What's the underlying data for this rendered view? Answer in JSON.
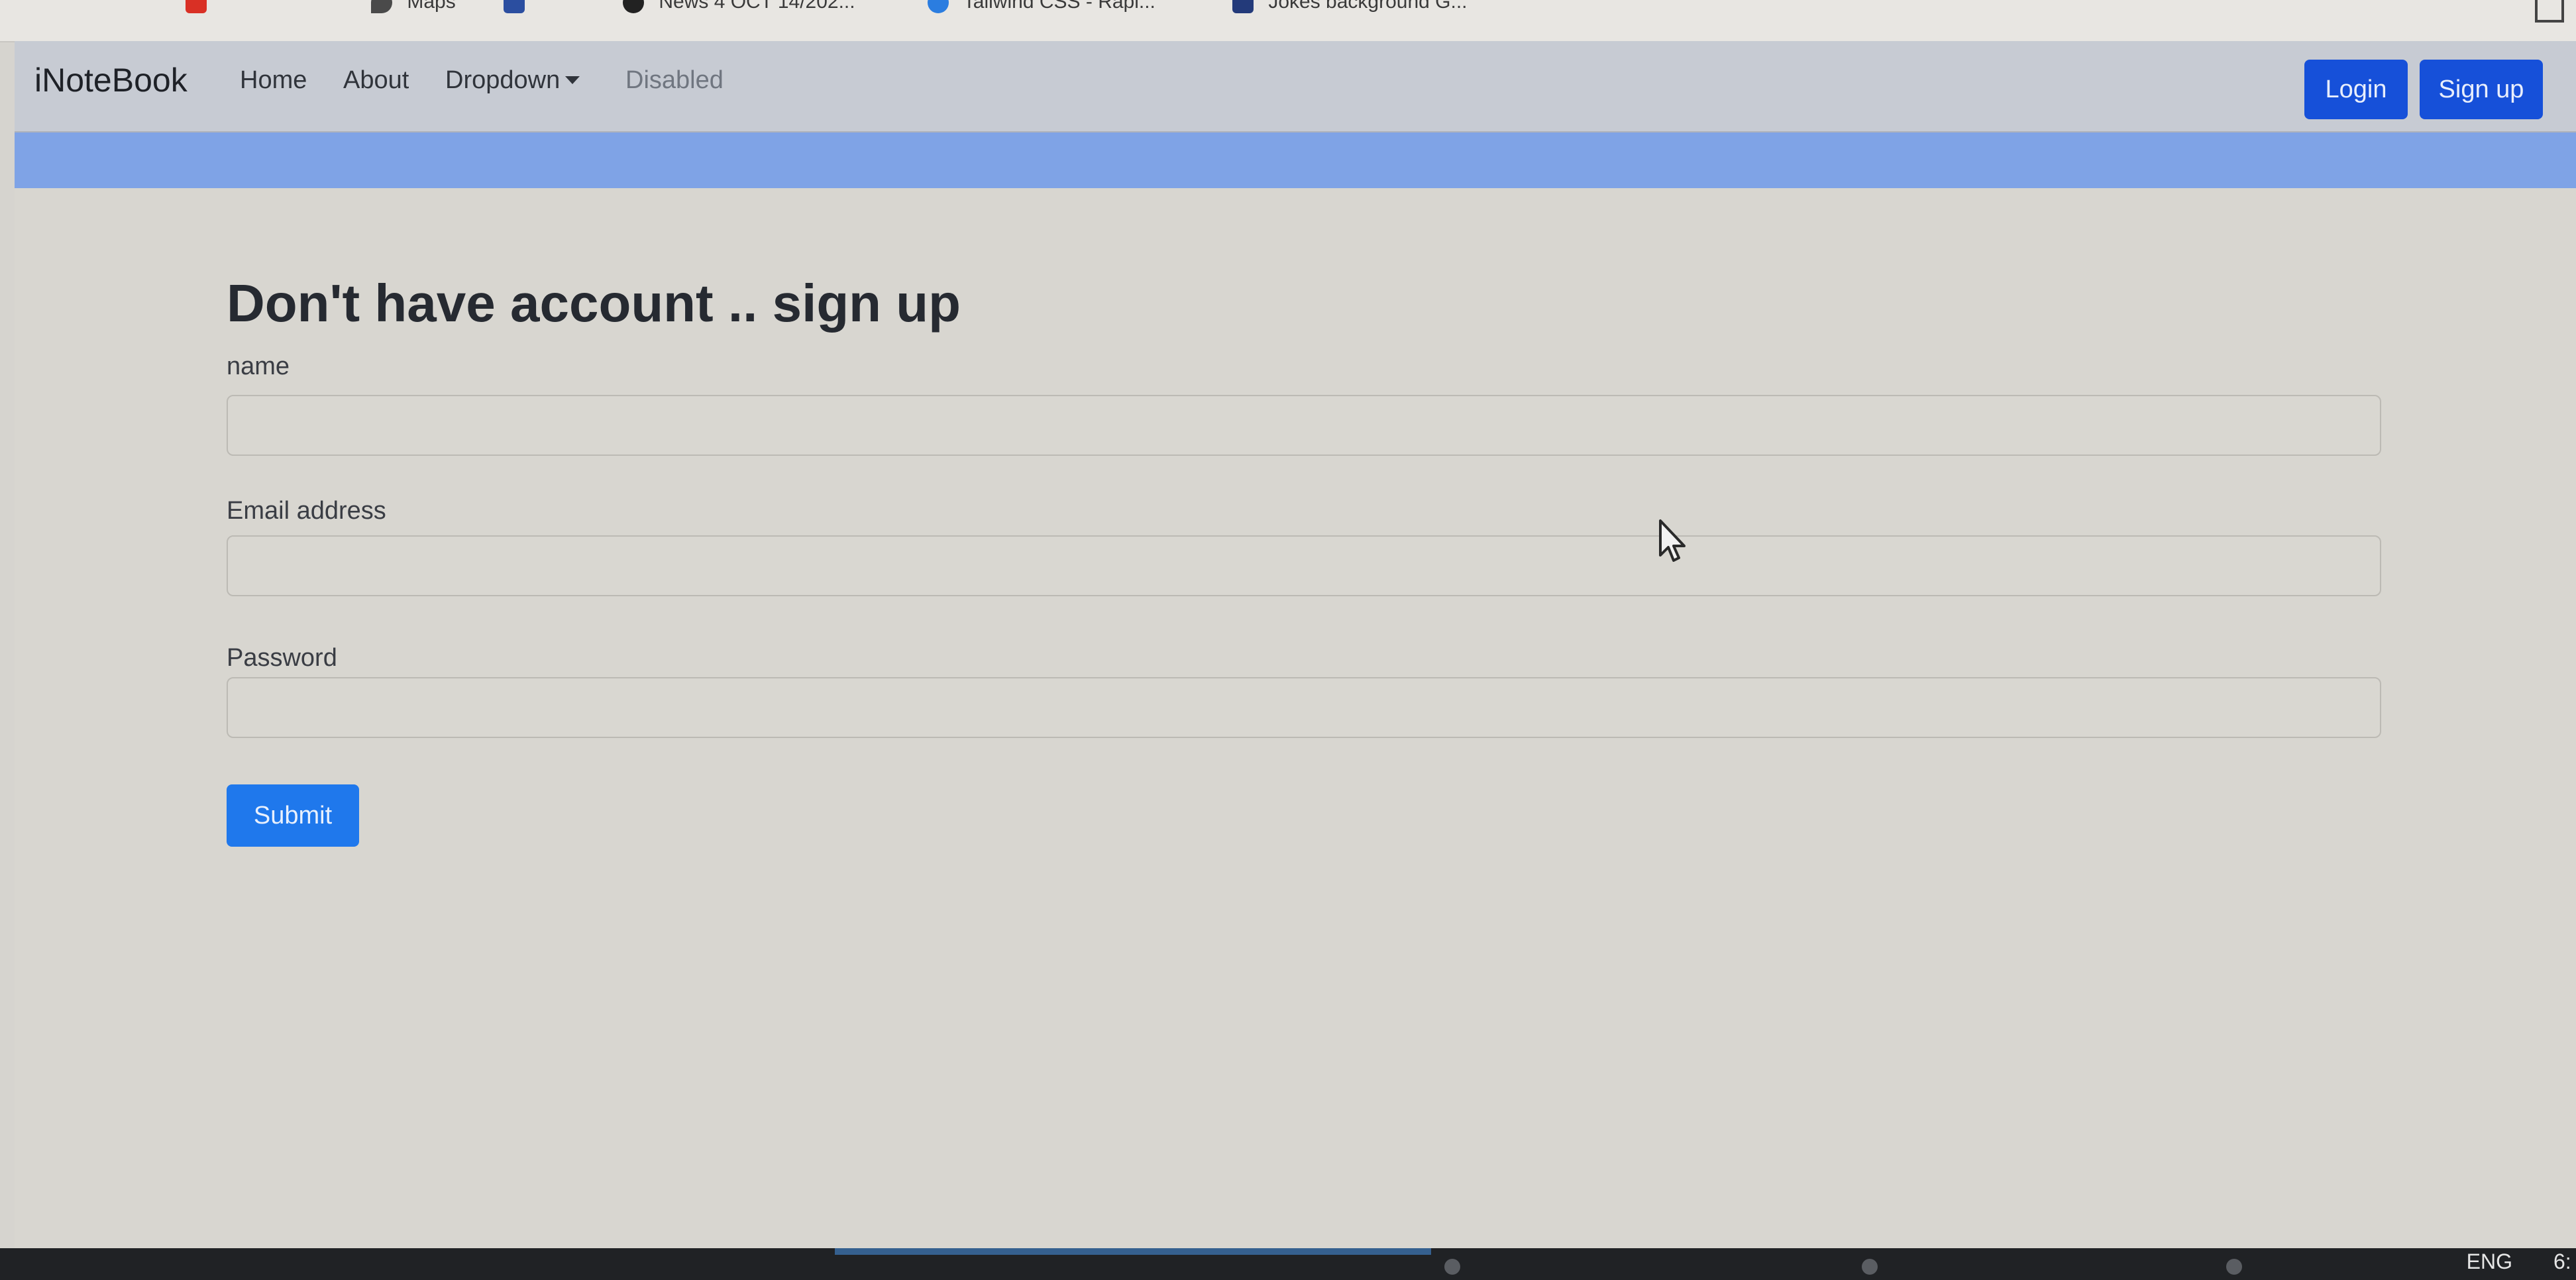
{
  "browser": {
    "bookmarks": [
      {
        "label": "",
        "icon": "red-tab-icon",
        "color": "#d93025"
      },
      {
        "label": "Maps",
        "icon": "maps-pin-icon",
        "color": "#4a4a4a"
      },
      {
        "label": "",
        "icon": "tab-icon",
        "color": "#2b4ea0"
      },
      {
        "label": "News 4 OCT 14/202...",
        "icon": "github-icon",
        "color": "#222222"
      },
      {
        "label": "Tailwind CSS - Rapi...",
        "icon": "tailwind-icon",
        "color": "#2b7de0"
      },
      {
        "label": "Jokes background G...",
        "icon": "image-icon",
        "color": "#233a7a"
      }
    ]
  },
  "navbar": {
    "brand": "iNoteBook",
    "links": {
      "home": "Home",
      "about": "About",
      "dropdown": "Dropdown",
      "disabled": "Disabled"
    },
    "login_label": "Login",
    "signup_label": "Sign up"
  },
  "form": {
    "title": "Don't have account .. sign up",
    "name_label": "name",
    "name_value": "",
    "email_label": "Email address",
    "email_value": "",
    "password_label": "Password",
    "password_value": "",
    "submit_label": "Submit"
  },
  "taskbar": {
    "language": "ENG",
    "clock": "6:"
  },
  "colors": {
    "primary_button": "#1650d9",
    "submit_button": "#1f78ec",
    "alert_strip": "#7fa3e6",
    "navbar_bg": "#c7cbd3",
    "page_bg": "#d8d6d0"
  }
}
